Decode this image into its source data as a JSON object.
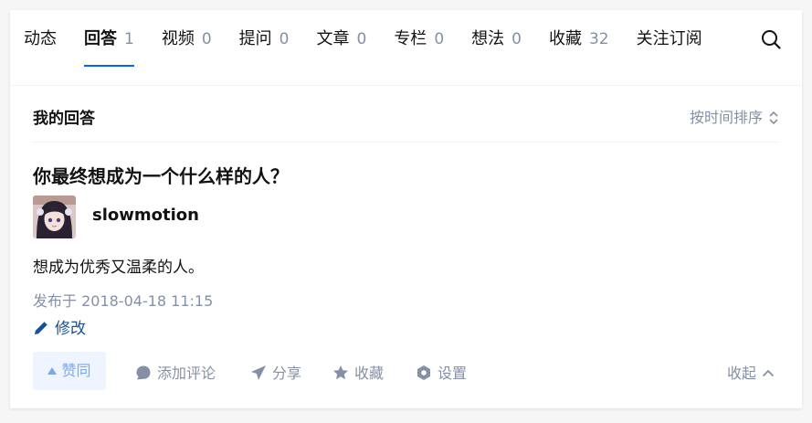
{
  "tabs": [
    {
      "label": "动态",
      "count": ""
    },
    {
      "label": "回答",
      "count": "1"
    },
    {
      "label": "视频",
      "count": "0"
    },
    {
      "label": "提问",
      "count": "0"
    },
    {
      "label": "文章",
      "count": "0"
    },
    {
      "label": "专栏",
      "count": "0"
    },
    {
      "label": "想法",
      "count": "0"
    },
    {
      "label": "收藏",
      "count": "32"
    },
    {
      "label": "关注订阅",
      "count": ""
    }
  ],
  "section": {
    "title": "我的回答",
    "sort_label": "按时间排序"
  },
  "answer": {
    "question": "你最终想成为一个什么样的人？",
    "author": "slowmotion",
    "content": "想成为优秀又温柔的人。",
    "published": "发布于 2018-04-18 11:15",
    "edit_label": "修改"
  },
  "actions": {
    "vote": "赞同",
    "comment": "添加评论",
    "share": "分享",
    "favorite": "收藏",
    "settings": "设置",
    "collapse": "收起"
  },
  "colors": {
    "accent": "#0066ff",
    "muted": "#8590a6",
    "link": "#175199",
    "vote_bg": "#eef5ff"
  }
}
